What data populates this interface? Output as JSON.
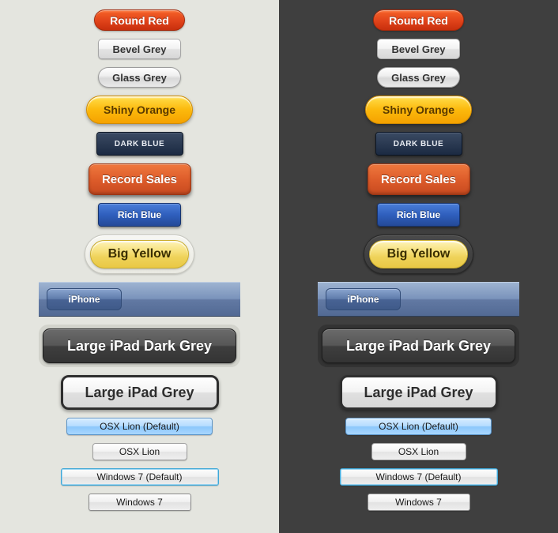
{
  "buttons": {
    "round_red": "Round Red",
    "bevel_grey": "Bevel Grey",
    "glass_grey": "Glass Grey",
    "shiny_orange": "Shiny Orange",
    "dark_blue": "DARK BLUE",
    "record_sales": "Record Sales",
    "rich_blue": "Rich Blue",
    "big_yellow": "Big Yellow",
    "iphone": "iPhone",
    "ipad_dark": "Large iPad Dark Grey",
    "ipad_grey": "Large iPad Grey",
    "osx_default": "OSX Lion (Default)",
    "osx_plain": "OSX Lion",
    "win7_default": "Windows 7 (Default)",
    "win7_plain": "Windows 7"
  },
  "panels": {
    "light_bg": "#e4e5df",
    "dark_bg": "#3f3f3f"
  },
  "colors": {
    "round_red": "#e2451b",
    "shiny_orange": "#fcb90c",
    "dark_blue": "#2b3a52",
    "record_sales": "#de5d2b",
    "rich_blue": "#2f5fbd",
    "big_yellow": "#efd35a",
    "iphone_bar": "#6279a3",
    "ipad_dark": "#3e3e3e",
    "osx_default_blue": "#8cc7fb",
    "win7_default_border": "#3fa7d6"
  }
}
